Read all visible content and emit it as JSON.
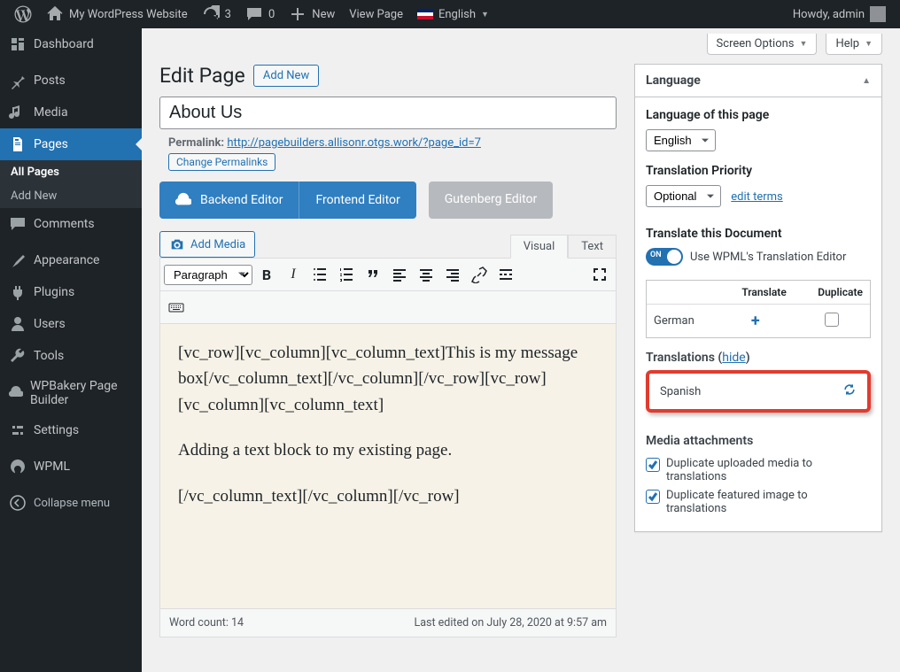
{
  "adminbar": {
    "site_name": "My WordPress Website",
    "updates": "3",
    "comments": "0",
    "new": "New",
    "view_page": "View Page",
    "language": "English",
    "howdy": "Howdy, admin"
  },
  "sidebar": {
    "dashboard": "Dashboard",
    "posts": "Posts",
    "media": "Media",
    "pages": "Pages",
    "pages_all": "All Pages",
    "pages_add": "Add New",
    "comments": "Comments",
    "appearance": "Appearance",
    "plugins": "Plugins",
    "users": "Users",
    "tools": "Tools",
    "wpbakery": "WPBakery Page Builder",
    "settings": "Settings",
    "wpml": "WPML",
    "collapse": "Collapse menu"
  },
  "topright": {
    "screen_options": "Screen Options",
    "help": "Help"
  },
  "page": {
    "heading": "Edit Page",
    "addnew": "Add New",
    "title_value": "About Us",
    "permalink_label": "Permalink:",
    "permalink_url": "http://pagebuilders.allisonr.otgs.work/?page_id=7",
    "change_permalinks": "Change Permalinks",
    "backend_editor": "Backend Editor",
    "frontend_editor": "Frontend Editor",
    "gutenberg_editor": "Gutenberg Editor",
    "add_media": "Add Media",
    "tab_visual": "Visual",
    "tab_text": "Text",
    "format_select": "Paragraph",
    "content_p1": "[vc_row][vc_column][vc_column_text]This is my message box[/vc_column_text][/vc_column][/vc_row][vc_row][vc_column][vc_column_text]",
    "content_p2": "Adding a text block to my existing page.",
    "content_p3": "[/vc_column_text][/vc_column][/vc_row]",
    "word_count": "Word count: 14",
    "last_edited": "Last edited on July 28, 2020 at 9:57 am"
  },
  "langbox": {
    "title": "Language",
    "lang_of_page": "Language of this page",
    "lang_value": "English",
    "priority_label": "Translation Priority",
    "priority_value": "Optional",
    "edit_terms": "edit terms",
    "translate_doc": "Translate this Document",
    "toggle_on": "ON",
    "use_wpml": "Use WPML's Translation Editor",
    "col_translate": "Translate",
    "col_duplicate": "Duplicate",
    "row_german": "German",
    "translations_label": "Translations",
    "hide": "hide",
    "spanish": "Spanish",
    "media_attachments": "Media attachments",
    "dup_uploaded": "Duplicate uploaded media to translations",
    "dup_featured": "Duplicate featured image to translations"
  }
}
